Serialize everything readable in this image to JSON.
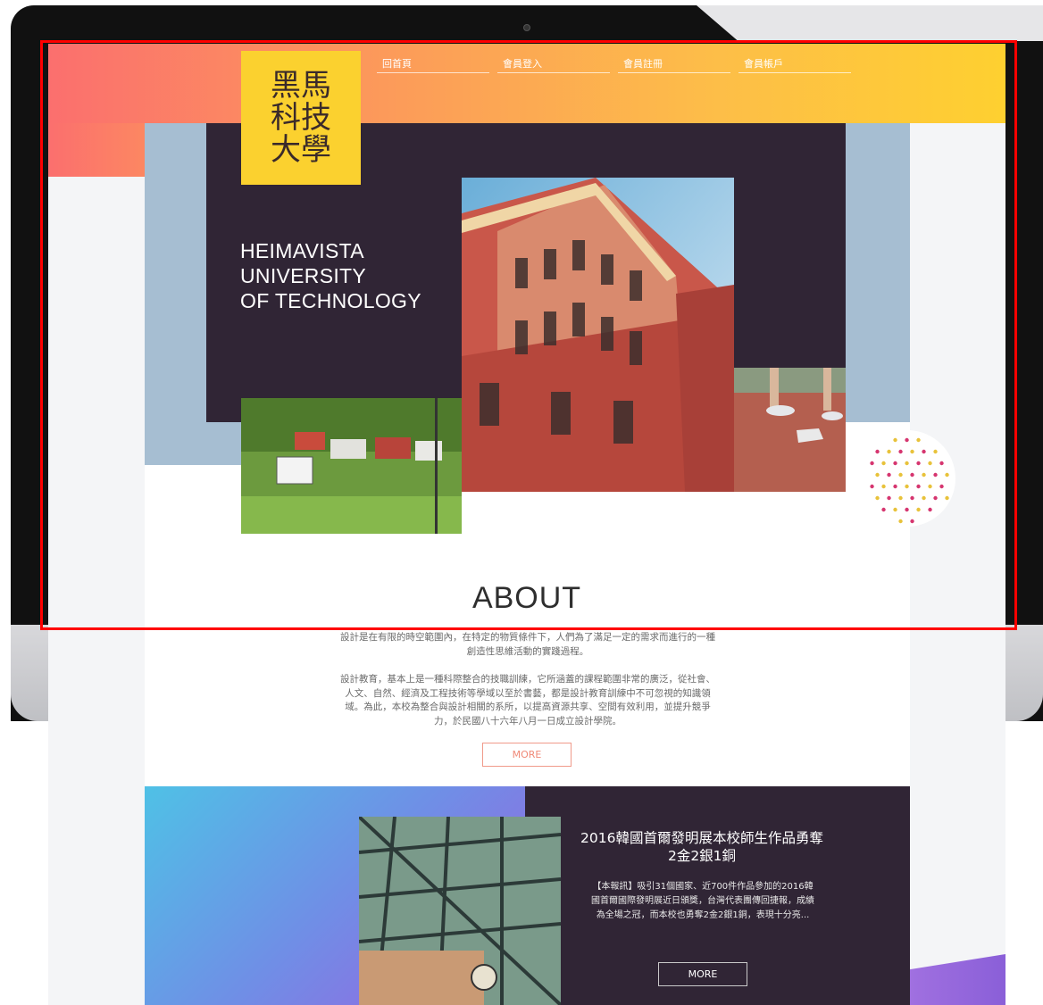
{
  "logo": {
    "text": "黑馬科技大學"
  },
  "nav": {
    "items": [
      {
        "label": "回首頁"
      },
      {
        "label": "會員登入"
      },
      {
        "label": "會員註冊"
      },
      {
        "label": "會員帳戶"
      }
    ]
  },
  "hero": {
    "university_name": "HEIMAVISTA\nUNIVERSITY\nOF TECHNOLOGY"
  },
  "about": {
    "title": "ABOUT",
    "paragraph1": "設計是在有限的時空範圍內，在特定的物質條件下，人們為了滿足一定的需求而進行的一種創造性思維活動的實踐過程。",
    "paragraph2": "設計教育，基本上是一種科際整合的技職訓練，它所涵蓋的課程範圍非常的廣泛，從社會、人文、自然、經濟及工程技術等學域以至於書藝，都是設計教育訓練中不可忽視的知識領域。為此，本校為整合與設計相關的系所，以提高資源共享、空間有效利用，並提升競爭力，於民國八十六年八月一日成立設計學院。",
    "more_label": "MORE"
  },
  "news": {
    "title": "2016韓國首爾發明展本校師生作品勇奪2金2銀1銅",
    "body": "【本報訊】吸引31個國家、近700件作品參加的2016韓國首爾國際發明展近日頒獎，台灣代表團傳回捷報，成績為全場之冠，而本校也勇奪2金2銀1銅，表現十分亮...",
    "more_label": "MORE"
  },
  "colors": {
    "header_gradient_start": "#fb6f6e",
    "header_gradient_end": "#fed030",
    "dark_panel": "#302535",
    "logo_yellow": "#fbd12f",
    "bluegrey": "#a6bed2",
    "highlight_frame": "#ff0000"
  }
}
